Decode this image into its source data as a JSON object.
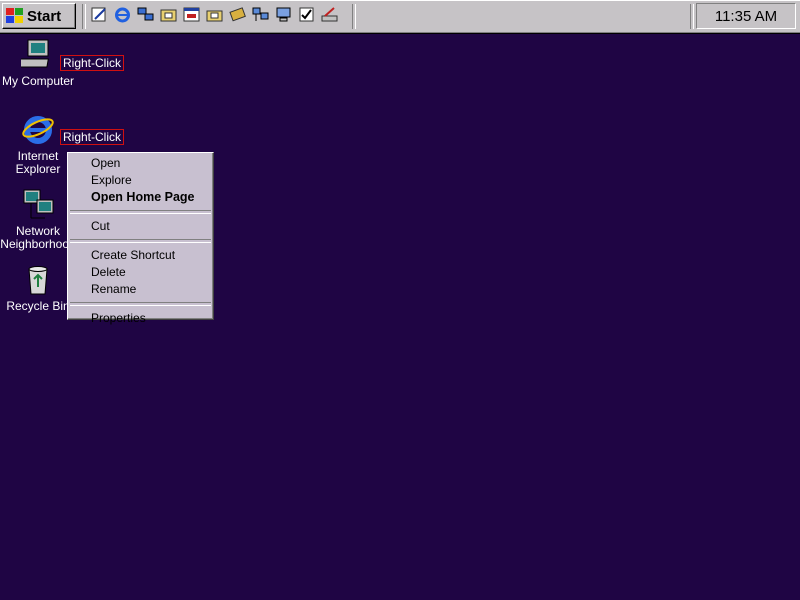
{
  "taskbar": {
    "start_label": "Start",
    "clock": "11:35 AM",
    "quick_launch": [
      "edit-icon",
      "ie-icon",
      "network-icon",
      "folder-image-icon",
      "window-icon",
      "folder-icon",
      "tools-icon",
      "computer-network-icon",
      "monitor-icon",
      "checklist-icon",
      "drafting-icon"
    ]
  },
  "desktop": {
    "icons": [
      {
        "label": "My Computer"
      },
      {
        "label_line1": "Internet",
        "label_line2": "Explorer"
      },
      {
        "label_line1": "Network",
        "label_line2": "Neighborhood"
      },
      {
        "label": "Recycle Bin"
      }
    ],
    "hints": [
      "Right-Click",
      "Right-Click"
    ]
  },
  "context_menu": {
    "items": {
      "open": "Open",
      "explore": "Explore",
      "open_home_page": "Open Home Page",
      "cut": "Cut",
      "create_shortcut": "Create Shortcut",
      "delete": "Delete",
      "rename": "Rename",
      "properties": "Properties"
    }
  },
  "colors": {
    "desktop": "#1f0544",
    "taskbar": "#c6c3c6",
    "menu": "#c8c0d0",
    "hint_border": "#d01010"
  }
}
